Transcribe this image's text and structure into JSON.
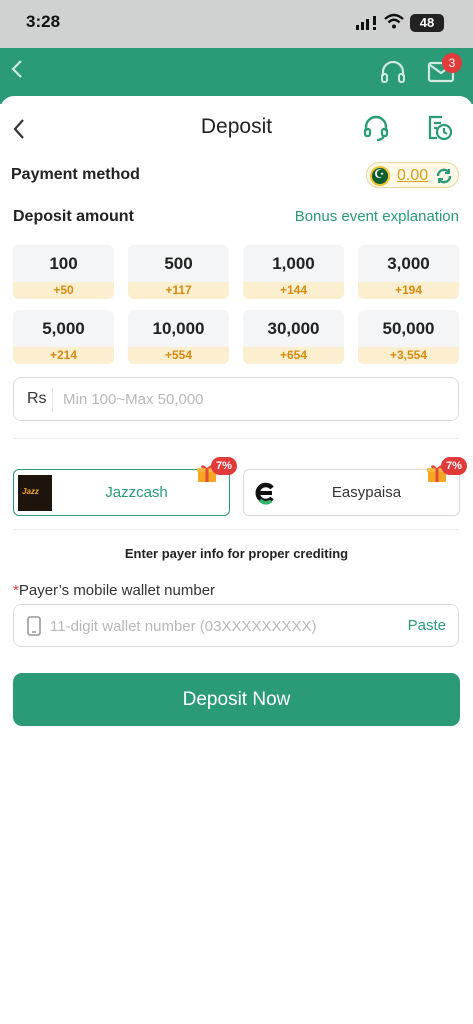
{
  "status_bar": {
    "time": "3:28",
    "battery": "48"
  },
  "app_bar": {
    "mail_badge": "3"
  },
  "header": {
    "title": "Deposit"
  },
  "payment_method": {
    "label": "Payment method",
    "balance": "0.00"
  },
  "deposit_amount": {
    "label": "Deposit amount",
    "bonus_link": "Bonus event explanation",
    "options": [
      {
        "amount": "100",
        "bonus": "+50"
      },
      {
        "amount": "500",
        "bonus": "+117"
      },
      {
        "amount": "1,000",
        "bonus": "+144"
      },
      {
        "amount": "3,000",
        "bonus": "+194"
      },
      {
        "amount": "5,000",
        "bonus": "+214"
      },
      {
        "amount": "10,000",
        "bonus": "+554"
      },
      {
        "amount": "30,000",
        "bonus": "+654"
      },
      {
        "amount": "50,000",
        "bonus": "+3,554"
      }
    ],
    "currency": "Rs",
    "placeholder": "Min 100~Max 50,000"
  },
  "channels": [
    {
      "name": "Jazzcash",
      "promo": "7%",
      "selected": true
    },
    {
      "name": "Easypaisa",
      "promo": "7%",
      "selected": false
    }
  ],
  "payer": {
    "note": "Enter payer info for proper crediting",
    "required_mark": "*",
    "wallet_label": "Payer’s mobile wallet number",
    "wallet_placeholder": "11-digit wallet number (03XXXXXXXXX)",
    "paste_label": "Paste"
  },
  "submit": {
    "label": "Deposit Now"
  },
  "colors": {
    "accent": "#2a9a77",
    "bonus": "#d68a0e",
    "promo": "#e03a3a"
  }
}
